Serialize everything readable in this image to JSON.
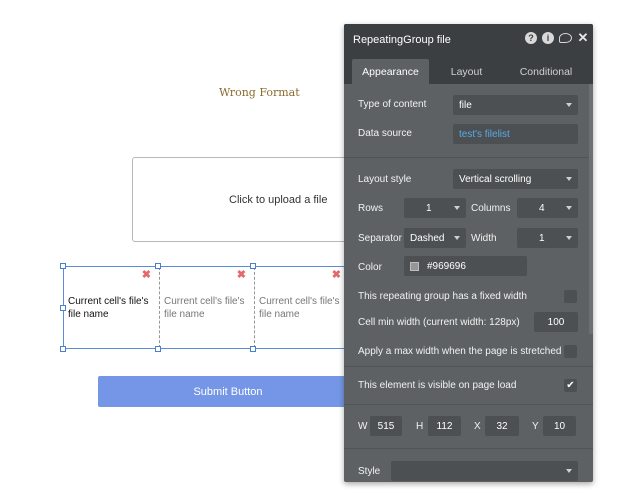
{
  "canvas": {
    "wrong_format": "Wrong Format",
    "upload_label": "Click to upload a file",
    "cells": [
      "Current cell's file's file name",
      "Current cell's file's file name",
      "Current cell's file's file name"
    ],
    "delete_glyph": "✖",
    "submit_label": "Submit Button"
  },
  "panel": {
    "title": "RepeatingGroup file",
    "icons": {
      "help": "?",
      "info": "i",
      "close": "✕"
    },
    "tabs": [
      "Appearance",
      "Layout",
      "Conditional"
    ],
    "type_of_content": {
      "label": "Type of content",
      "value": "file"
    },
    "data_source": {
      "label": "Data source",
      "value": "test's filelist"
    },
    "layout_style": {
      "label": "Layout style",
      "value": "Vertical scrolling"
    },
    "rows": {
      "label": "Rows",
      "value": "1"
    },
    "columns": {
      "label": "Columns",
      "value": "4"
    },
    "separator": {
      "label": "Separator",
      "value": "Dashed"
    },
    "width": {
      "label": "Width",
      "value": "1"
    },
    "color": {
      "label": "Color",
      "value": "#969696"
    },
    "fixed_width": {
      "label": "This repeating group has a fixed width",
      "checked": false
    },
    "cell_min_width": {
      "label": "Cell min width (current width: 128px)",
      "value": "100"
    },
    "max_width": {
      "label": "Apply a max width when the page is stretched",
      "checked": false
    },
    "visible": {
      "label": "This element is visible on page load",
      "checked": true,
      "check_glyph": "✔"
    },
    "geometry": {
      "w_label": "W",
      "w": "515",
      "h_label": "H",
      "h": "112",
      "x_label": "X",
      "x": "32",
      "y_label": "Y",
      "y": "10"
    },
    "style": {
      "label": "Style",
      "value": ""
    }
  },
  "colors": {
    "panel_bg": "#5d6163",
    "panel_header": "#3b3f41",
    "accent_link": "#5aa9e6",
    "submit": "#7596e6",
    "delete": "#e26a6a"
  }
}
